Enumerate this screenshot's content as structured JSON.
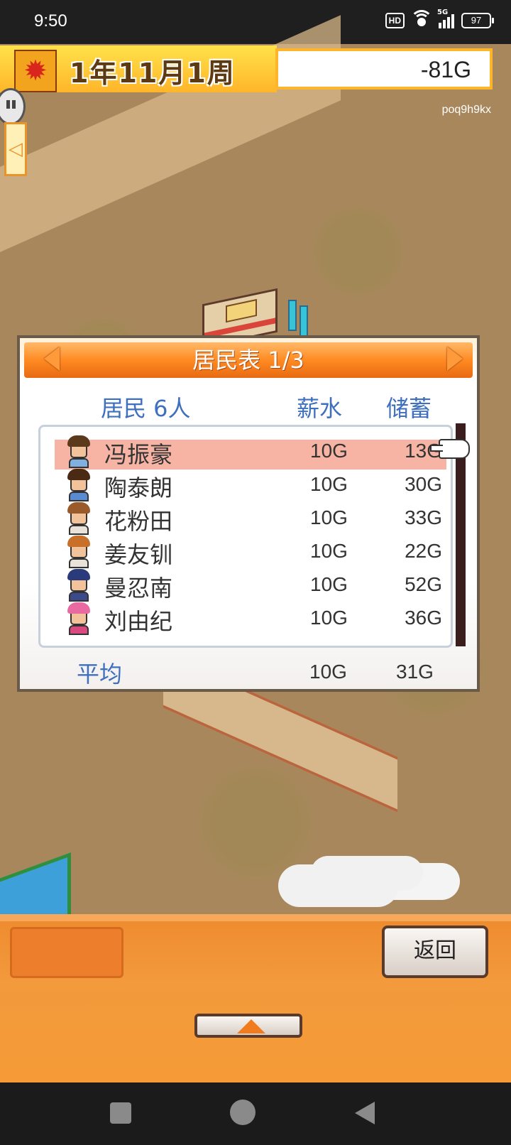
{
  "status_bar": {
    "time": "9:50",
    "hd_label": "HD",
    "network_label": "5G",
    "battery": "97"
  },
  "hud": {
    "date": "1年11月1周",
    "money": "-81G",
    "user_id": "poq9h9kx",
    "season_icon": "maple-leaf-icon"
  },
  "dialog": {
    "title": "居民表 1/3",
    "header_residents": "居民 6人",
    "header_salary": "薪水",
    "header_savings": "储蓄",
    "rows": [
      {
        "name": "冯振豪",
        "salary": "10G",
        "savings": "13G",
        "hair": "#5a3a1a",
        "shirt": "#7fb0e0"
      },
      {
        "name": "陶泰朗",
        "salary": "10G",
        "savings": "30G",
        "hair": "#4a2a12",
        "shirt": "#5a8ad0"
      },
      {
        "name": "花粉田",
        "salary": "10G",
        "savings": "33G",
        "hair": "#9a5a2a",
        "shirt": "#e8e2d8"
      },
      {
        "name": "姜友钏",
        "salary": "10G",
        "savings": "22G",
        "hair": "#c8702a",
        "shirt": "#e8e2d8"
      },
      {
        "name": "曼忍南",
        "salary": "10G",
        "savings": "52G",
        "hair": "#2a3a7a",
        "shirt": "#3a4a8a"
      },
      {
        "name": "刘由纪",
        "salary": "10G",
        "savings": "36G",
        "hair": "#e86aa0",
        "shirt": "#d84a80"
      }
    ],
    "selected_index": 0,
    "avg_label": "平均",
    "avg_salary": "10G",
    "avg_savings": "31G"
  },
  "bottom": {
    "back_label": "返回"
  },
  "colors": {
    "header_text": "#3f6fbf",
    "accent_orange": "#ff8a22",
    "selected_row": "#f7b4a4"
  }
}
